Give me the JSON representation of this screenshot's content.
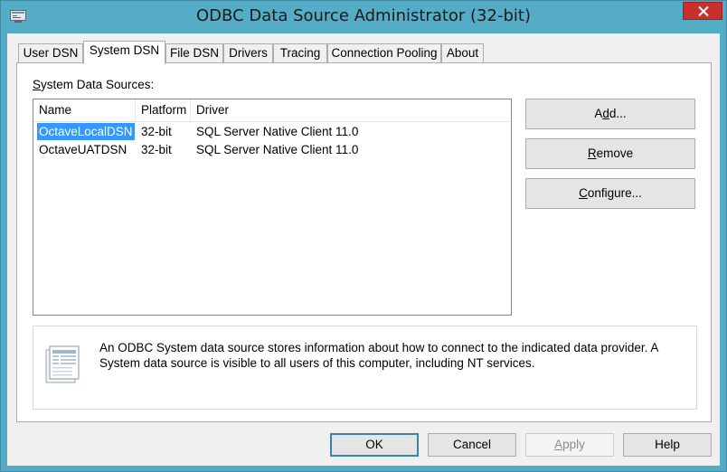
{
  "window": {
    "title": "ODBC Data Source Administrator (32-bit)",
    "accent_color": "#55acc6",
    "close_color": "#c7302d"
  },
  "tabs": [
    {
      "label": "User DSN",
      "active": false
    },
    {
      "label": "System DSN",
      "active": true
    },
    {
      "label": "File DSN",
      "active": false
    },
    {
      "label": "Drivers",
      "active": false
    },
    {
      "label": "Tracing",
      "active": false
    },
    {
      "label": "Connection Pooling",
      "active": false
    },
    {
      "label": "About",
      "active": false
    }
  ],
  "system_dsn": {
    "list_label_prefix": "S",
    "list_label_rest": "ystem Data Sources:",
    "columns": [
      "Name",
      "Platform",
      "Driver"
    ],
    "rows": [
      {
        "name": "OctaveLocalDSN",
        "platform": "32-bit",
        "driver": "SQL Server Native Client 11.0",
        "selected": true
      },
      {
        "name": "OctaveUATDSN",
        "platform": "32-bit",
        "driver": "SQL Server Native Client 11.0",
        "selected": false
      }
    ],
    "buttons": {
      "add_pre": "A",
      "add_acc": "d",
      "add_post": "d...",
      "remove_pre": "",
      "remove_acc": "R",
      "remove_post": "emove",
      "configure_pre": "",
      "configure_acc": "C",
      "configure_post": "onfigure..."
    },
    "info_text": "An ODBC System data source stores information about how to connect to the indicated data provider.   A System data source is visible to all users of this computer, including NT services."
  },
  "footer": {
    "ok": "OK",
    "cancel": "Cancel",
    "apply_acc": "A",
    "apply_post": "pply",
    "help": "Help"
  },
  "icons": {
    "app": "odbc-admin-icon",
    "close": "close-icon",
    "info": "data-sheet-icon"
  }
}
